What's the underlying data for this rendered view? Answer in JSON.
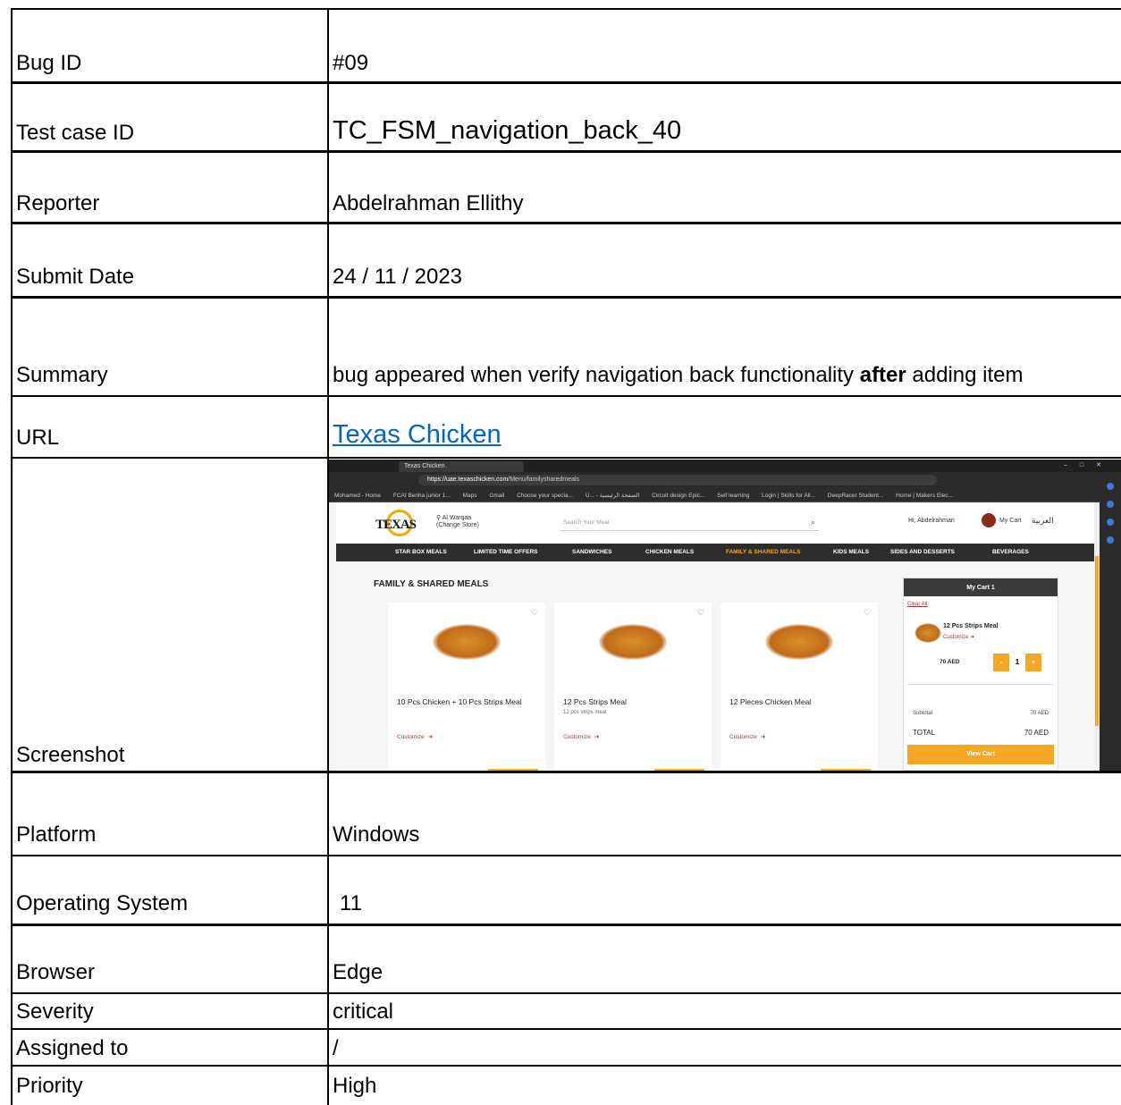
{
  "fields": {
    "bug_id": {
      "label": "Bug ID",
      "value": "#09"
    },
    "test_case_id": {
      "label": "Test case ID",
      "value": "TC_FSM_navigation_back_40"
    },
    "reporter": {
      "label": "Reporter",
      "value": "Abdelrahman Ellithy"
    },
    "submit_date": {
      "label": "Submit Date",
      "value": "24 / 11 / 2023"
    },
    "summary": {
      "label": "Summary",
      "value_before": "bug appeared when verify navigation back functionality ",
      "value_bold": "after",
      "value_after": " adding item"
    },
    "url": {
      "label": "URL",
      "link_text": "Texas Chicken"
    },
    "screenshot": {
      "label": "Screenshot"
    },
    "platform": {
      "label": "Platform",
      "value": "Windows"
    },
    "os": {
      "label": "Operating System",
      "value": "11"
    },
    "browser": {
      "label": "Browser",
      "value": "Edge"
    },
    "severity": {
      "label": "Severity",
      "value": "critical"
    },
    "assigned_to": {
      "label": "Assigned to",
      "value": "/"
    },
    "priority": {
      "label": "Priority",
      "value": "High"
    }
  },
  "shot": {
    "tab_title": "Texas Chicken",
    "url_host": "https://uae.texaschicken.com",
    "url_path": "/Menu/familysharedmeals",
    "bookmarks": [
      "Mohamed - Home",
      "FCAI Benha junior 1...",
      "Maps",
      "Gmail",
      "Choose your specia...",
      "U... - الصفحة الرئيسية",
      "Circuit design Epic...",
      "Self learning",
      "Login | Skills for All...",
      "DeepRacer Student...",
      "Home | Makers Elec..."
    ],
    "logo": "TEXAS",
    "store_line1": "Al Warqaa",
    "store_line2": "(Change Store)",
    "search_placeholder": "Search Your Meal",
    "user_greeting": "Hi, Abdelrahman",
    "cart_badge": "1",
    "cart_label": "My Cart",
    "lang": "العربية",
    "nav": [
      "STAR BOX MEALS",
      "LIMITED TIME OFFERS",
      "SANDWICHES",
      "CHICKEN MEALS",
      "FAMILY & SHARED MEALS",
      "KIDS MEALS",
      "SIDES AND DESSERTS",
      "BEVERAGES"
    ],
    "nav_active_index": 4,
    "category_title": "FAMILY & SHARED MEALS",
    "products": [
      {
        "name": "10 Pcs Chicken + 10 Pcs Strips Meal",
        "desc": "",
        "customize": "Customize"
      },
      {
        "name": "12 Pcs Strips Meal",
        "desc": "12 pcs strips meal",
        "customize": "Customize"
      },
      {
        "name": "12 Pieces Chicken Meal",
        "desc": "",
        "customize": "Customize"
      }
    ],
    "cart": {
      "title": "My Cart 1",
      "clear_all": "Clear All",
      "item_name": "12 Pcs Strips Meal",
      "item_customize": "Customize",
      "item_price": "70 AED",
      "qty_minus": "-",
      "qty": "1",
      "qty_plus": "+",
      "subtotal_label": "Subtotal",
      "subtotal_value": "70 AED",
      "total_label": "TOTAL",
      "total_value": "70 AED",
      "view_cart": "View Cart"
    }
  }
}
